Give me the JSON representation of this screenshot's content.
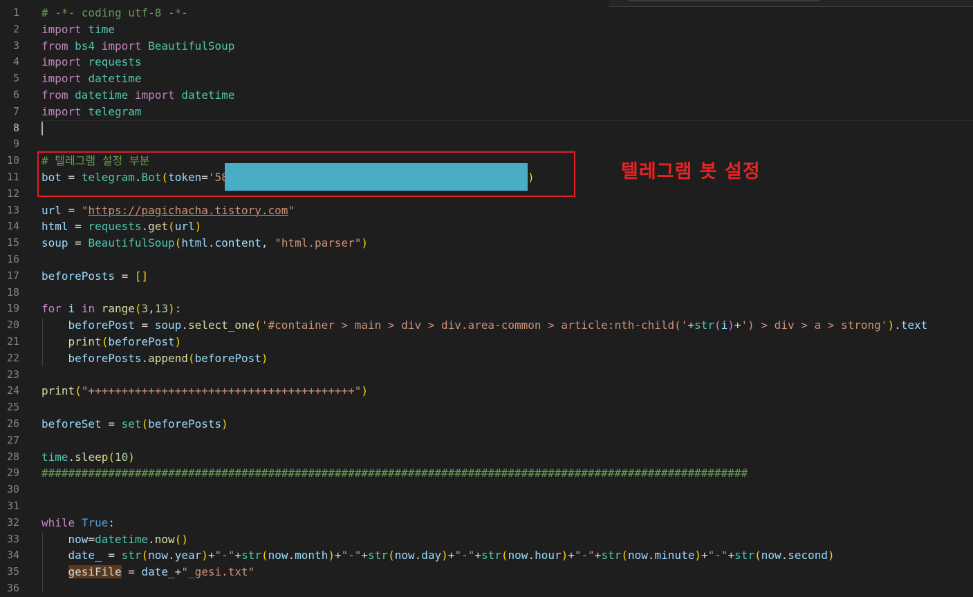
{
  "lines": [
    {
      "n": "1",
      "t": [
        [
          "cmt",
          "# -*- coding utf-8 -*-"
        ]
      ]
    },
    {
      "n": "2",
      "t": [
        [
          "kw",
          "import"
        ],
        [
          "op",
          " "
        ],
        [
          "mod",
          "time"
        ]
      ]
    },
    {
      "n": "3",
      "t": [
        [
          "kw",
          "from"
        ],
        [
          "op",
          " "
        ],
        [
          "mod",
          "bs4"
        ],
        [
          "op",
          " "
        ],
        [
          "kw",
          "import"
        ],
        [
          "op",
          " "
        ],
        [
          "cls",
          "BeautifulSoup"
        ]
      ]
    },
    {
      "n": "4",
      "t": [
        [
          "kw",
          "import"
        ],
        [
          "op",
          " "
        ],
        [
          "mod",
          "requests"
        ]
      ]
    },
    {
      "n": "5",
      "t": [
        [
          "kw",
          "import"
        ],
        [
          "op",
          " "
        ],
        [
          "mod",
          "datetime"
        ]
      ]
    },
    {
      "n": "6",
      "t": [
        [
          "kw",
          "from"
        ],
        [
          "op",
          " "
        ],
        [
          "mod",
          "datetime"
        ],
        [
          "op",
          " "
        ],
        [
          "kw",
          "import"
        ],
        [
          "op",
          " "
        ],
        [
          "cls",
          "datetime"
        ]
      ]
    },
    {
      "n": "7",
      "t": [
        [
          "kw",
          "import"
        ],
        [
          "op",
          " "
        ],
        [
          "mod",
          "telegram"
        ]
      ]
    },
    {
      "n": "8",
      "t": []
    },
    {
      "n": "9",
      "t": []
    },
    {
      "n": "10",
      "t": [
        [
          "cmt",
          "# 텔레그램 설정 부분"
        ]
      ]
    },
    {
      "n": "11",
      "t": [
        [
          "var",
          "bot"
        ],
        [
          "op",
          " = "
        ],
        [
          "mod",
          "telegram"
        ],
        [
          "op",
          "."
        ],
        [
          "cls",
          "Bot"
        ],
        [
          "p1",
          "("
        ],
        [
          "var",
          "token"
        ],
        [
          "op",
          "="
        ],
        [
          "str",
          "'58"
        ]
      ]
    },
    {
      "n": "12",
      "t": []
    },
    {
      "n": "13",
      "t": [
        [
          "var",
          "url"
        ],
        [
          "op",
          " = "
        ],
        [
          "str",
          "\""
        ],
        [
          "url",
          "https://pagichacha.tistory.com"
        ],
        [
          "str",
          "\""
        ]
      ]
    },
    {
      "n": "14",
      "t": [
        [
          "var",
          "html"
        ],
        [
          "op",
          " = "
        ],
        [
          "mod",
          "requests"
        ],
        [
          "op",
          "."
        ],
        [
          "fn",
          "get"
        ],
        [
          "p1",
          "("
        ],
        [
          "var",
          "url"
        ],
        [
          "p1",
          ")"
        ]
      ]
    },
    {
      "n": "15",
      "t": [
        [
          "var",
          "soup"
        ],
        [
          "op",
          " = "
        ],
        [
          "cls",
          "BeautifulSoup"
        ],
        [
          "p1",
          "("
        ],
        [
          "var",
          "html"
        ],
        [
          "op",
          "."
        ],
        [
          "var",
          "content"
        ],
        [
          "op",
          ", "
        ],
        [
          "str",
          "\"html.parser\""
        ],
        [
          "p1",
          ")"
        ]
      ]
    },
    {
      "n": "16",
      "t": []
    },
    {
      "n": "17",
      "t": [
        [
          "var",
          "beforePosts"
        ],
        [
          "op",
          " = "
        ],
        [
          "p1",
          "[]"
        ]
      ]
    },
    {
      "n": "18",
      "t": []
    },
    {
      "n": "19",
      "t": [
        [
          "kw",
          "for"
        ],
        [
          "op",
          " "
        ],
        [
          "var",
          "i"
        ],
        [
          "op",
          " "
        ],
        [
          "kw",
          "in"
        ],
        [
          "op",
          " "
        ],
        [
          "fn",
          "range"
        ],
        [
          "p1",
          "("
        ],
        [
          "num",
          "3"
        ],
        [
          "op",
          ","
        ],
        [
          "num",
          "13"
        ],
        [
          "p1",
          ")"
        ],
        [
          "op",
          ":"
        ]
      ]
    },
    {
      "n": "20",
      "t": [
        [
          "op",
          "    "
        ],
        [
          "var",
          "beforePost"
        ],
        [
          "op",
          " = "
        ],
        [
          "var",
          "soup"
        ],
        [
          "op",
          "."
        ],
        [
          "fn",
          "select_one"
        ],
        [
          "p1",
          "("
        ],
        [
          "str",
          "'#container > main > div > div.area-common > article:nth-child('"
        ],
        [
          "op",
          "+"
        ],
        [
          "cls",
          "str"
        ],
        [
          "p2",
          "("
        ],
        [
          "var",
          "i"
        ],
        [
          "p2",
          ")"
        ],
        [
          "op",
          "+"
        ],
        [
          "str",
          "') > div > a > strong'"
        ],
        [
          "p1",
          ")"
        ],
        [
          "op",
          "."
        ],
        [
          "var",
          "text"
        ]
      ]
    },
    {
      "n": "21",
      "t": [
        [
          "op",
          "    "
        ],
        [
          "fn",
          "print"
        ],
        [
          "p1",
          "("
        ],
        [
          "var",
          "beforePost"
        ],
        [
          "p1",
          ")"
        ]
      ]
    },
    {
      "n": "22",
      "t": [
        [
          "op",
          "    "
        ],
        [
          "var",
          "beforePosts"
        ],
        [
          "op",
          "."
        ],
        [
          "fn",
          "append"
        ],
        [
          "p1",
          "("
        ],
        [
          "var",
          "beforePost"
        ],
        [
          "p1",
          ")"
        ]
      ]
    },
    {
      "n": "23",
      "t": []
    },
    {
      "n": "24",
      "t": [
        [
          "fn",
          "print"
        ],
        [
          "p1",
          "("
        ],
        [
          "str",
          "\"++++++++++++++++++++++++++++++++++++++++\""
        ],
        [
          "p1",
          ")"
        ]
      ]
    },
    {
      "n": "25",
      "t": []
    },
    {
      "n": "26",
      "t": [
        [
          "var",
          "beforeSet"
        ],
        [
          "op",
          " = "
        ],
        [
          "cls",
          "set"
        ],
        [
          "p1",
          "("
        ],
        [
          "var",
          "beforePosts"
        ],
        [
          "p1",
          ")"
        ]
      ]
    },
    {
      "n": "27",
      "t": []
    },
    {
      "n": "28",
      "t": [
        [
          "mod",
          "time"
        ],
        [
          "op",
          "."
        ],
        [
          "fn",
          "sleep"
        ],
        [
          "p1",
          "("
        ],
        [
          "num",
          "10"
        ],
        [
          "p1",
          ")"
        ]
      ]
    },
    {
      "n": "29",
      "t": [
        [
          "cmt",
          "##########################################################################################################"
        ]
      ]
    },
    {
      "n": "30",
      "t": []
    },
    {
      "n": "31",
      "t": []
    },
    {
      "n": "32",
      "t": [
        [
          "kw",
          "while"
        ],
        [
          "op",
          " "
        ],
        [
          "kw2",
          "True"
        ],
        [
          "op",
          ":"
        ]
      ]
    },
    {
      "n": "33",
      "t": [
        [
          "op",
          "    "
        ],
        [
          "var",
          "now"
        ],
        [
          "op",
          "="
        ],
        [
          "cls",
          "datetime"
        ],
        [
          "op",
          "."
        ],
        [
          "fn",
          "now"
        ],
        [
          "p1",
          "()"
        ]
      ]
    },
    {
      "n": "34",
      "t": [
        [
          "op",
          "    "
        ],
        [
          "var",
          "date_"
        ],
        [
          "op",
          " = "
        ],
        [
          "cls",
          "str"
        ],
        [
          "p1",
          "("
        ],
        [
          "var",
          "now"
        ],
        [
          "op",
          "."
        ],
        [
          "var",
          "year"
        ],
        [
          "p1",
          ")"
        ],
        [
          "op",
          "+"
        ],
        [
          "str",
          "\"-\""
        ],
        [
          "op",
          "+"
        ],
        [
          "cls",
          "str"
        ],
        [
          "p1",
          "("
        ],
        [
          "var",
          "now"
        ],
        [
          "op",
          "."
        ],
        [
          "var",
          "month"
        ],
        [
          "p1",
          ")"
        ],
        [
          "op",
          "+"
        ],
        [
          "str",
          "\"-\""
        ],
        [
          "op",
          "+"
        ],
        [
          "cls",
          "str"
        ],
        [
          "p1",
          "("
        ],
        [
          "var",
          "now"
        ],
        [
          "op",
          "."
        ],
        [
          "var",
          "day"
        ],
        [
          "p1",
          ")"
        ],
        [
          "op",
          "+"
        ],
        [
          "str",
          "\"-\""
        ],
        [
          "op",
          "+"
        ],
        [
          "cls",
          "str"
        ],
        [
          "p1",
          "("
        ],
        [
          "var",
          "now"
        ],
        [
          "op",
          "."
        ],
        [
          "var",
          "hour"
        ],
        [
          "p1",
          ")"
        ],
        [
          "op",
          "+"
        ],
        [
          "str",
          "\"-\""
        ],
        [
          "op",
          "+"
        ],
        [
          "cls",
          "str"
        ],
        [
          "p1",
          "("
        ],
        [
          "var",
          "now"
        ],
        [
          "op",
          "."
        ],
        [
          "var",
          "minute"
        ],
        [
          "p1",
          ")"
        ],
        [
          "op",
          "+"
        ],
        [
          "str",
          "\"-\""
        ],
        [
          "op",
          "+"
        ],
        [
          "cls",
          "str"
        ],
        [
          "p1",
          "("
        ],
        [
          "var",
          "now"
        ],
        [
          "op",
          "."
        ],
        [
          "var",
          "second"
        ],
        [
          "p1",
          ")"
        ]
      ]
    },
    {
      "n": "35",
      "t": [
        [
          "op",
          "    "
        ],
        [
          "hl",
          "gesiFile"
        ],
        [
          "op",
          " = "
        ],
        [
          "var",
          "date_"
        ],
        [
          "op",
          "+"
        ],
        [
          "str",
          "\"_gesi.txt\""
        ]
      ]
    },
    {
      "n": "36",
      "t": []
    }
  ],
  "line11_close_paren": ")",
  "annotation": "텔레그램 봇 설정",
  "active_line": "8"
}
